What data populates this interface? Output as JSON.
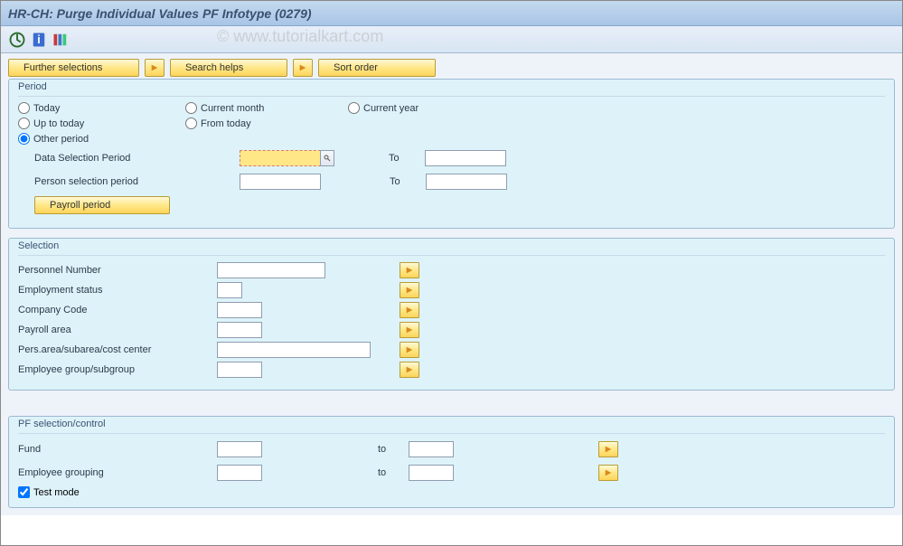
{
  "title": "HR-CH: Purge Individual Values PF Infotype (0279)",
  "watermark": "© www.tutorialkart.com",
  "buttons": {
    "further": "Further selections",
    "search_helps": "Search helps",
    "sort_order": "Sort order",
    "payroll_period": "Payroll period"
  },
  "group": {
    "period": "Period",
    "selection": "Selection",
    "pf": "PF selection/control"
  },
  "radios": {
    "today": "Today",
    "current_month": "Current month",
    "current_year": "Current year",
    "up_to_today": "Up to today",
    "from_today": "From today",
    "other_period": "Other period"
  },
  "period": {
    "data_sel_label": "Data Selection Period",
    "person_sel_label": "Person selection period",
    "to_label": "To"
  },
  "selection": {
    "pernr": "Personnel Number",
    "emp_status": "Employment status",
    "company_code": "Company Code",
    "payroll_area": "Payroll area",
    "pers_area": "Pers.area/subarea/cost center",
    "emp_group": "Employee group/subgroup"
  },
  "pf": {
    "fund": "Fund",
    "emp_grouping": "Employee grouping",
    "to": "to",
    "test_mode": "Test mode"
  }
}
